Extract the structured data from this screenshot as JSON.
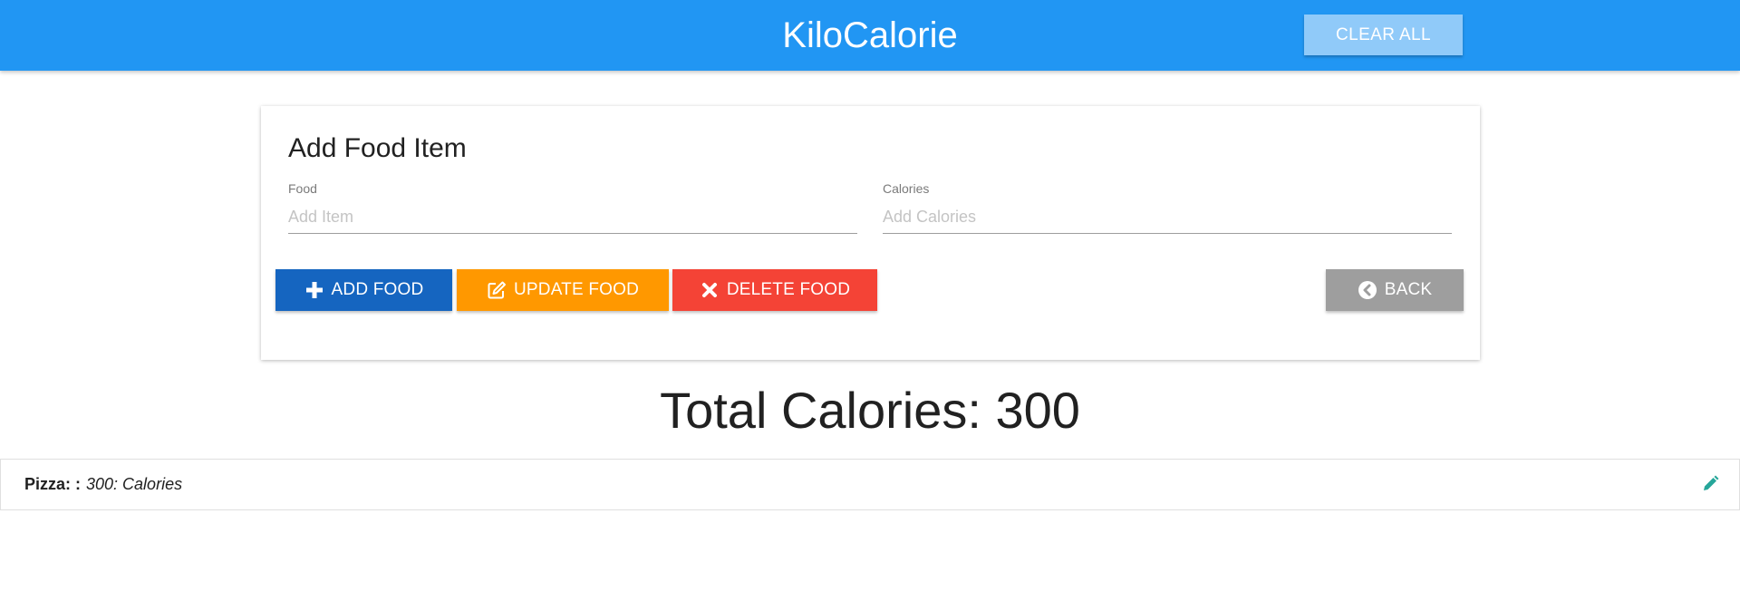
{
  "header": {
    "title": "KiloCalorie",
    "clear_all_label": "CLEAR ALL"
  },
  "form": {
    "title": "Add Food Item",
    "food": {
      "label": "Food",
      "placeholder": "Add Item",
      "value": ""
    },
    "calories": {
      "label": "Calories",
      "placeholder": "Add Calories",
      "value": ""
    },
    "buttons": {
      "add_label": "ADD FOOD",
      "update_label": "UPDATE FOOD",
      "delete_label": "DELETE FOOD",
      "back_label": "BACK"
    }
  },
  "total": {
    "text": "Total Calories: 300"
  },
  "items": [
    {
      "name": "Pizza: :",
      "calories_text": "300: Calories"
    }
  ],
  "icons": {
    "add": "plus-icon",
    "update": "edit-square-icon",
    "delete": "x-icon",
    "back": "chevron-circle-left-icon",
    "item_edit": "pencil-icon"
  },
  "colors": {
    "navbar": "#2196f3",
    "clear_all": "#90caf9",
    "add": "#1565c0",
    "update": "#ff9800",
    "delete": "#f44336",
    "back": "#9e9e9e",
    "edit_icon": "#26a69a"
  }
}
